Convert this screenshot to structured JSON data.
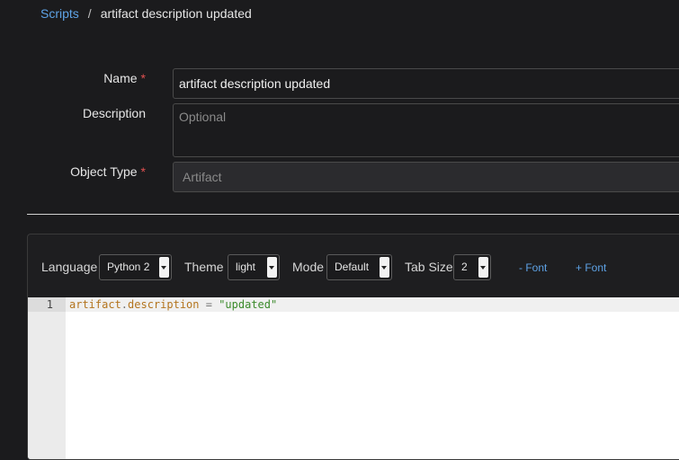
{
  "breadcrumb": {
    "parent": "Scripts",
    "separator": "/",
    "current": "artifact description updated"
  },
  "form": {
    "name_label": "Name",
    "name_value": "artifact description updated",
    "description_label": "Description",
    "description_placeholder": "Optional",
    "object_type_label": "Object Type",
    "object_type_value": "Artifact",
    "required_marker": "*"
  },
  "editor": {
    "language_label": "Language",
    "language_value": "Python 2",
    "theme_label": "Theme",
    "theme_value": "light",
    "mode_label": "Mode",
    "mode_value": "Default",
    "tab_size_label": "Tab Size",
    "tab_size_value": "2",
    "font_decrease_label": "- Font",
    "font_increase_label": "+ Font",
    "lines": [
      {
        "number": "1",
        "tokens": {
          "object": "artifact",
          "dot": ".",
          "attr": "description",
          "op": " = ",
          "string": "\"updated\""
        }
      }
    ]
  },
  "colors": {
    "background": "#1b1b1d",
    "link": "#5ea3e6",
    "required": "#e05050",
    "code_identifier": "#b3741e",
    "code_string": "#3b8a2b"
  }
}
